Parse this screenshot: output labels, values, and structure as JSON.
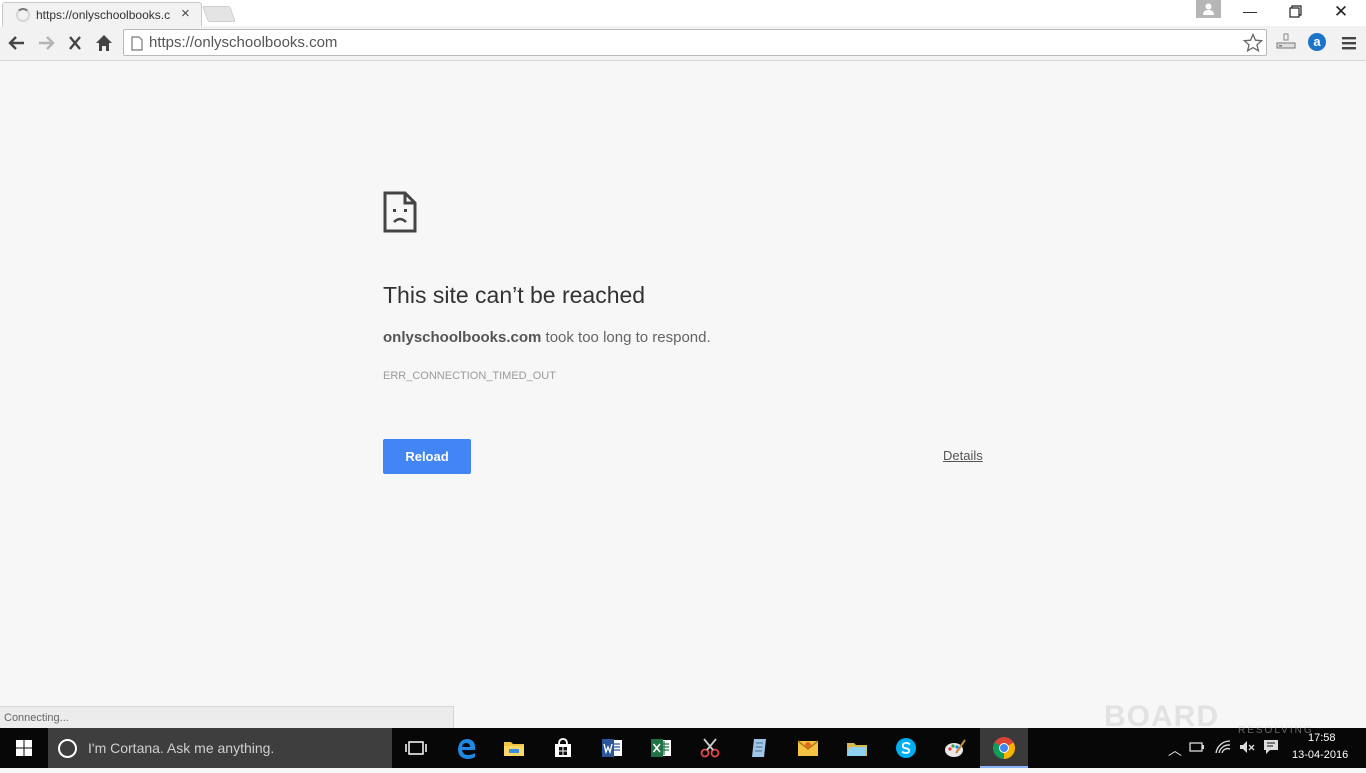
{
  "browser": {
    "tab": {
      "title": "https://onlyschoolbooks.c",
      "close": "×"
    },
    "window_controls": {
      "minimize": "—",
      "close": "✕"
    },
    "omnibox": {
      "url": "https://onlyschoolbooks.com"
    },
    "extension_label": "a",
    "status_text": "Connecting..."
  },
  "error_page": {
    "title": "This site can’t be reached",
    "domain": "onlyschoolbooks.com",
    "message": " took too long to respond.",
    "code": "ERR_CONNECTION_TIMED_OUT",
    "reload_label": "Reload",
    "details_label": "Details"
  },
  "taskbar": {
    "cortana_placeholder": "I'm Cortana. Ask me anything.",
    "clock_time": "17:58",
    "clock_date": "13-04-2016"
  },
  "watermark": {
    "main": "BOARD",
    "sub": "RESOLVING"
  },
  "colors": {
    "accent": "#4285f4",
    "taskbar": "#070707",
    "page_bg": "#f7f7f7"
  }
}
